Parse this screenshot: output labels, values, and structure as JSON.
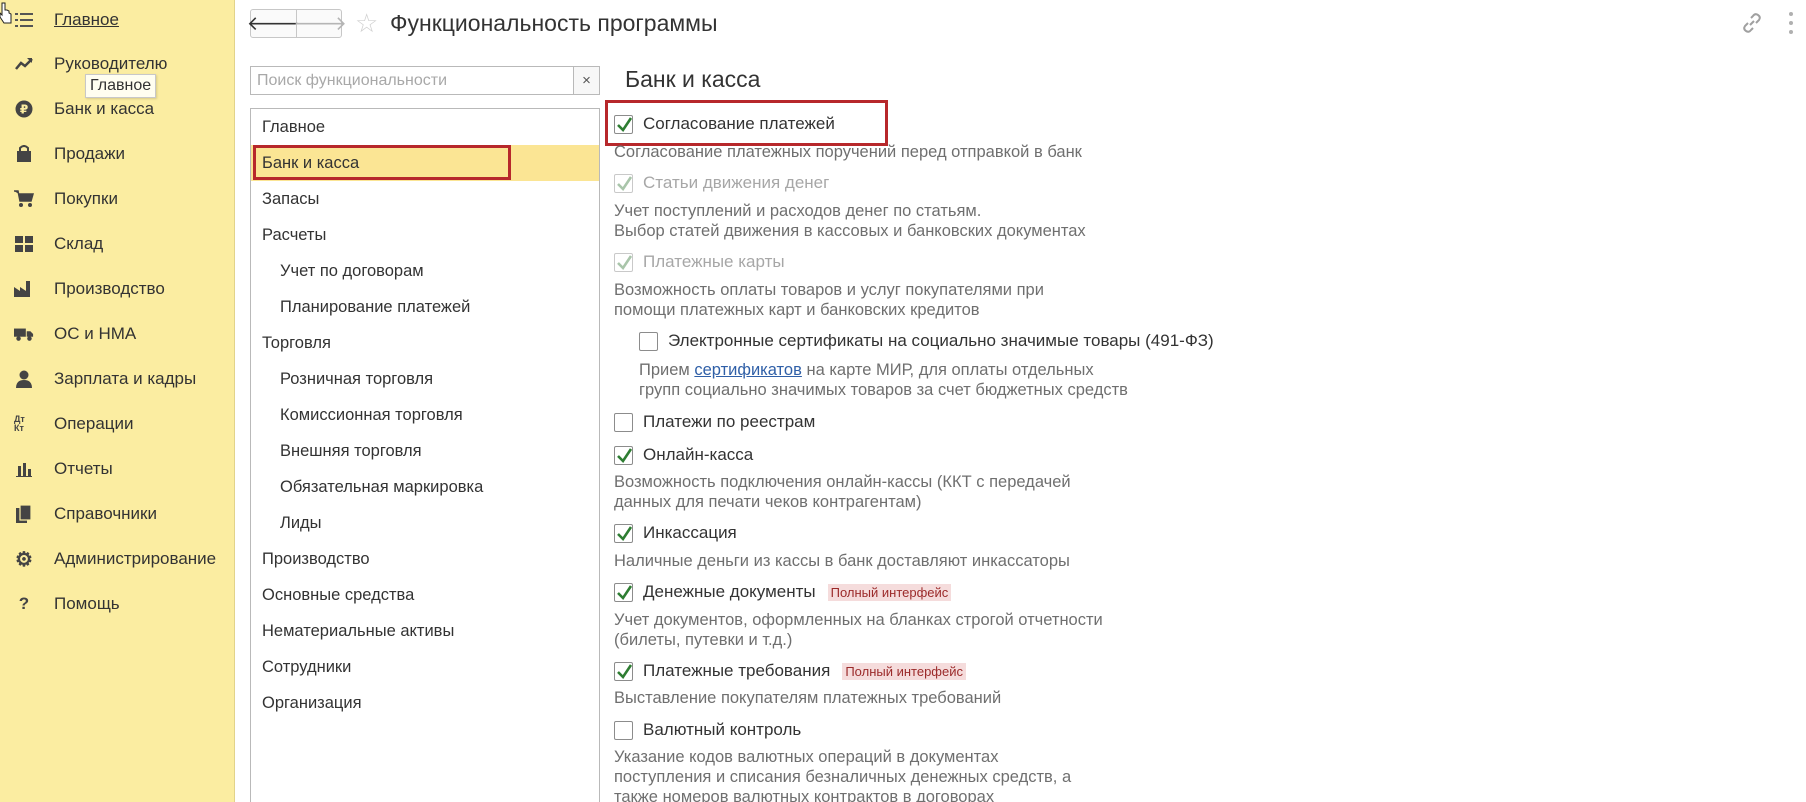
{
  "sidebar": {
    "items": [
      {
        "label": "Главное",
        "icon": "menu-lines-icon"
      },
      {
        "label": "Руководителю",
        "icon": "trend-up-icon"
      },
      {
        "label": "Банк и касса",
        "icon": "ruble-coin-icon"
      },
      {
        "label": "Продажи",
        "icon": "shopping-bag-icon"
      },
      {
        "label": "Покупки",
        "icon": "cart-icon"
      },
      {
        "label": "Склад",
        "icon": "warehouse-grid-icon"
      },
      {
        "label": "Производство",
        "icon": "factory-icon"
      },
      {
        "label": "ОС и НМА",
        "icon": "truck-icon"
      },
      {
        "label": "Зарплата и кадры",
        "icon": "person-icon"
      },
      {
        "label": "Операции",
        "icon": "dt-kt-icon"
      },
      {
        "label": "Отчеты",
        "icon": "bar-chart-icon"
      },
      {
        "label": "Справочники",
        "icon": "books-icon"
      },
      {
        "label": "Администрирование",
        "icon": "gear-icon"
      },
      {
        "label": "Помощь",
        "icon": "question-icon"
      }
    ],
    "tooltip": "Главное",
    "dt_kt_glyph": "Дт Кт",
    "help_glyph": "?"
  },
  "header": {
    "title": "Функциональность программы",
    "back_glyph": "🡐",
    "forward_glyph": "🡒",
    "star_glyph": "☆"
  },
  "search": {
    "placeholder": "Поиск функциональности",
    "value": "",
    "clear_glyph": "×"
  },
  "sections": [
    {
      "label": "Главное",
      "level": 0
    },
    {
      "label": "Банк и касса",
      "level": 0,
      "selected": true
    },
    {
      "label": "Запасы",
      "level": 0
    },
    {
      "label": "Расчеты",
      "level": 0
    },
    {
      "label": "Учет по договорам",
      "level": 1
    },
    {
      "label": "Планирование платежей",
      "level": 1
    },
    {
      "label": "Торговля",
      "level": 0
    },
    {
      "label": "Розничная торговля",
      "level": 1
    },
    {
      "label": "Комиссионная торговля",
      "level": 1
    },
    {
      "label": "Внешняя торговля",
      "level": 1
    },
    {
      "label": "Обязательная маркировка",
      "level": 1
    },
    {
      "label": "Лиды",
      "level": 1
    },
    {
      "label": "Производство",
      "level": 0
    },
    {
      "label": "Основные средства",
      "level": 0
    },
    {
      "label": "Нематериальные активы",
      "level": 0
    },
    {
      "label": "Сотрудники",
      "level": 0
    },
    {
      "label": "Организация",
      "level": 0
    }
  ],
  "content": {
    "group_title": "Банк и касса",
    "options": [
      {
        "label": "Согласование платежей",
        "checked": true,
        "disabled": false,
        "description": [
          "Согласование платежных поручений перед отправкой в банк"
        ]
      },
      {
        "label": "Статьи движения денег",
        "checked": true,
        "disabled": true,
        "description": [
          "Учет поступлений и расходов денег по статьям.",
          "Выбор статей движения в кассовых и банковских документах"
        ]
      },
      {
        "label": "Платежные карты",
        "checked": true,
        "disabled": true,
        "description": [
          "Возможность оплаты товаров и услуг покупателями при",
          "помощи платежных карт и банковских кредитов"
        ]
      },
      {
        "label": "Электронные сертификаты на социально значимые товары (491-ФЗ)",
        "checked": false,
        "disabled": false,
        "description_prefix": "Прием ",
        "description_link": "сертификатов",
        "description_suffix": " на карте МИР, для оплаты отдельных",
        "description_line2": "групп социально значимых товаров за счет бюджетных средств"
      },
      {
        "label": "Платежи по реестрам",
        "checked": false,
        "disabled": false,
        "description": []
      },
      {
        "label": "Онлайн-касса",
        "checked": true,
        "disabled": false,
        "description": [
          "Возможность подключения онлайн-кассы (ККТ с передачей",
          "данных для печати чеков контрагентам)"
        ]
      },
      {
        "label": "Инкассация",
        "checked": true,
        "disabled": false,
        "description": [
          "Наличные деньги из кассы в банк доставляют инкассаторы"
        ]
      },
      {
        "label": "Денежные документы",
        "checked": true,
        "disabled": false,
        "badge": "Полный интерфейс",
        "description": [
          "Учет документов, оформленных на бланках строгой отчетности",
          "(билеты, путевки и т.д.)"
        ]
      },
      {
        "label": "Платежные требования",
        "checked": true,
        "disabled": false,
        "badge": "Полный интерфейс",
        "description": [
          "Выставление покупателям платежных требований"
        ]
      },
      {
        "label": "Валютный контроль",
        "checked": false,
        "disabled": false,
        "description": [
          "Указание кодов валютных операций в документах",
          "поступления и списания безналичных денежных средств, а",
          "также номеров валютных контрактов в договорах"
        ]
      }
    ]
  },
  "colors": {
    "sidebar_bg": "#fbeda1",
    "selected_row": "#fbe594",
    "highlight_frame": "#b7282b",
    "checkmark": "#2e7d32",
    "link": "#2f5fa7"
  }
}
